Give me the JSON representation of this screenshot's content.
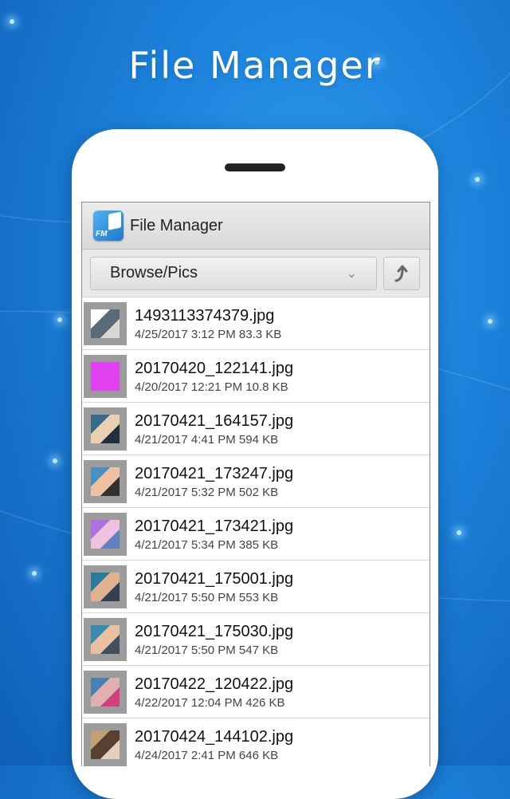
{
  "promo": {
    "title": "File Manager"
  },
  "app": {
    "title": "File Manager",
    "logo_text": "FM"
  },
  "pathbar": {
    "current_path": "Browse/Pics",
    "up_icon": "up-arrow-icon"
  },
  "files": [
    {
      "name": "1493113374379.jpg",
      "meta": "4/25/2017 3:12 PM  83.3 KB",
      "thumb_colors": [
        "#ffffff",
        "#5a6a7a",
        "#d8d8d8"
      ]
    },
    {
      "name": "20170420_122141.jpg",
      "meta": "4/20/2017 12:21 PM  10.8 KB",
      "thumb_colors": [
        "#e040f0",
        "#e040f0",
        "#e040f0"
      ]
    },
    {
      "name": "20170421_164157.jpg",
      "meta": "4/21/2017 4:41 PM  594 KB",
      "thumb_colors": [
        "#3a6a8a",
        "#e8d0b0",
        "#203040"
      ]
    },
    {
      "name": "20170421_173247.jpg",
      "meta": "4/21/2017 5:32 PM  502 KB",
      "thumb_colors": [
        "#4a90c0",
        "#f0c0a0",
        "#303030"
      ]
    },
    {
      "name": "20170421_173421.jpg",
      "meta": "4/21/2017 5:34 PM  385 KB",
      "thumb_colors": [
        "#b070e0",
        "#f0c0e0",
        "#6080c0"
      ]
    },
    {
      "name": "20170421_175001.jpg",
      "meta": "4/21/2017 5:50 PM  553 KB",
      "thumb_colors": [
        "#2a7a9a",
        "#e0b090",
        "#304050"
      ]
    },
    {
      "name": "20170421_175030.jpg",
      "meta": "4/21/2017 5:50 PM  547 KB",
      "thumb_colors": [
        "#3a8ab0",
        "#e8c0a0",
        "#405060"
      ]
    },
    {
      "name": "20170422_120422.jpg",
      "meta": "4/22/2017 12:04 PM  426 KB",
      "thumb_colors": [
        "#4a80b0",
        "#e0b0b0",
        "#d04080"
      ]
    },
    {
      "name": "20170424_144102.jpg",
      "meta": "4/24/2017 2:41 PM  646 KB",
      "thumb_colors": [
        "#c0a070",
        "#5a4030",
        "#e0d0c0"
      ]
    }
  ]
}
